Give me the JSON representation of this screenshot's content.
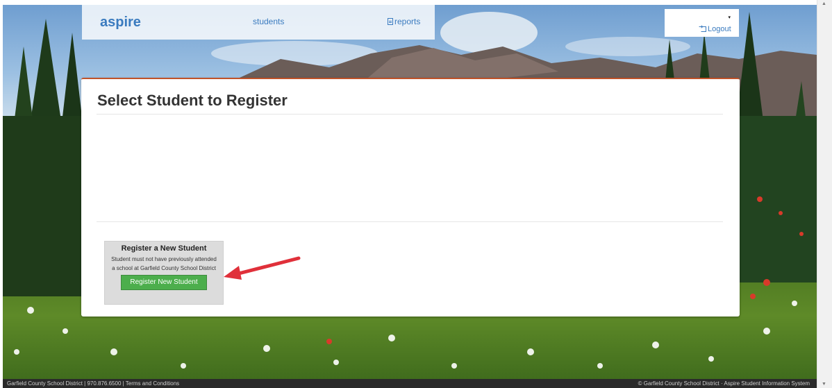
{
  "nav": {
    "brand": "aspire",
    "students_link": "students",
    "reports_link": "reports"
  },
  "user_menu": {
    "caret": "▾",
    "logout_label": "Logout"
  },
  "panel": {
    "title": "Select Student to Register"
  },
  "register_card": {
    "title": "Register a New Student",
    "description": "Student must not have previously attended a school at Garfield County School District",
    "button_label": "Register New Student"
  },
  "status_bar": {
    "left_text": "Garfield County School District | 970.876.6500 | Terms and Conditions",
    "right_text": "© Garfield County School District · Aspire Student Information System"
  },
  "colors": {
    "accent": "#3a7bbf",
    "panel_border": "#c0542a",
    "button_green": "#4cae4c",
    "arrow_red": "#e0303a"
  },
  "icons": {
    "reports": "document-icon",
    "logout": "sign-out-icon",
    "annotation": "red-arrow-icon"
  }
}
